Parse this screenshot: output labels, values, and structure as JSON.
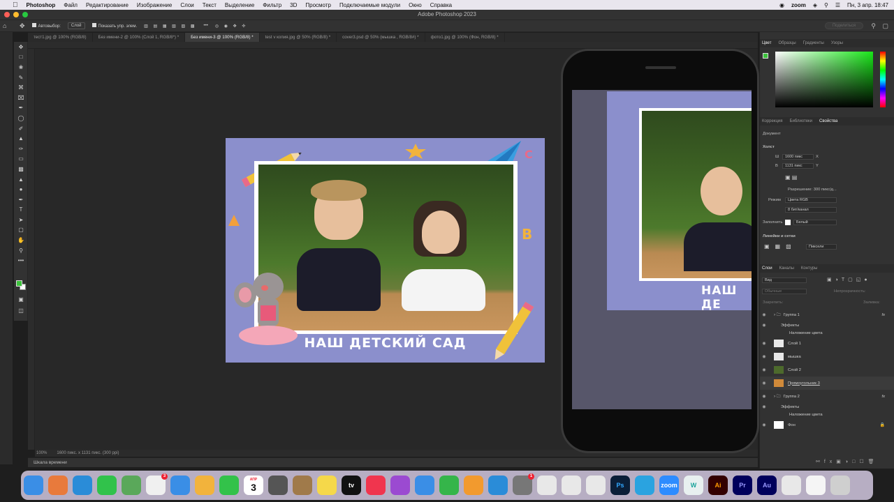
{
  "menubar": {
    "app": "Photoshop",
    "items": [
      "Файл",
      "Редактирование",
      "Изображение",
      "Слои",
      "Текст",
      "Выделение",
      "Фильтр",
      "3D",
      "Просмотр",
      "Подключаемые модули",
      "Окно",
      "Справка"
    ],
    "zoom": "zoom",
    "datetime": "Пн, 3 апр. 18:47"
  },
  "window": {
    "title": "Adobe Photoshop 2023"
  },
  "options": {
    "autoselect_label": "Автовыбор:",
    "autoselect_value": "Слой",
    "show_transform_label": "Показать упр. элем.",
    "share_label": "Поделиться"
  },
  "tabs": [
    "тест1.jpg @ 100% (RGB/8)",
    "Без имени-2 @ 100% (Слой 1, RGB/8*) *",
    "Без имени-3 @ 100% (RGB/8) *",
    "test v копия.jpg @ 50% (RGB/8) *",
    "cover3.psd @ 50% (мышка , RGB/8#) *",
    "фото1.jpg @ 100% (Фон, RGB/8) *"
  ],
  "document": {
    "caption": "НАШ ДЕТСКИЙ САД",
    "letter_b": "B",
    "letter_c": "C"
  },
  "phone": {
    "caption": "НАШ ДЕ"
  },
  "status": {
    "zoom": "100%",
    "size": "1600 пикс. x 1131 пикс. (300 ppi)"
  },
  "timeline": {
    "label": "Шкала времени"
  },
  "panels": {
    "color_tabs": [
      "Цвет",
      "Образцы",
      "Градиенты",
      "Узоры"
    ],
    "props_tabs": [
      "Коррекция",
      "Библиотеки",
      "Свойства"
    ],
    "document_label": "Документ",
    "canvas_label": "Холст",
    "width_label": "Ш",
    "width_value": "1600 пикс",
    "width_unit": "X",
    "height_label": "В",
    "height_value": "1131 пикс",
    "height_unit": "Y",
    "resolution": "Разрешение: 300 пикс/д...",
    "mode_label": "Режим",
    "mode_value": "Цвета RGB",
    "depth_value": "8 бит/канал",
    "fill_label": "Заполнить",
    "fill_value": "Белый",
    "rulers_label": "Линейки и сетки",
    "units_value": "Пиксели",
    "layers_tabs": [
      "Слои",
      "Каналы",
      "Контуры"
    ],
    "kind_value": "Вид",
    "blend_value": "Обычные",
    "opacity_label": "Непрозрачность:",
    "lock_label": "Закрепить:",
    "fill2_label": "Заливка:",
    "layers": [
      {
        "name": "Группа 1",
        "kind": "group",
        "fx": "fx"
      },
      {
        "name": "Эффекты",
        "kind": "sub"
      },
      {
        "name": "Наложение цвета",
        "kind": "sub2"
      },
      {
        "name": "Слой 1",
        "kind": "layer"
      },
      {
        "name": "мышка",
        "kind": "layer"
      },
      {
        "name": "Слой 2",
        "kind": "photo"
      },
      {
        "name": "Прямоугольник 3",
        "kind": "rect"
      },
      {
        "name": "Группа 2",
        "kind": "group",
        "fx": "fx"
      },
      {
        "name": "Эффекты",
        "kind": "sub"
      },
      {
        "name": "Наложение цвета",
        "kind": "sub2"
      },
      {
        "name": "Фон",
        "kind": "bg"
      }
    ]
  },
  "dock": {
    "calendar_month": "АПР",
    "calendar_day": "3",
    "apps": [
      {
        "name": "finder",
        "label": "",
        "color": "#3a8ee6"
      },
      {
        "name": "launchpad",
        "label": "",
        "color": "#e87a3c"
      },
      {
        "name": "safari",
        "label": "",
        "color": "#2a8cd8"
      },
      {
        "name": "messages",
        "label": "",
        "color": "#31c24b"
      },
      {
        "name": "maps",
        "label": "",
        "color": "#5aa85a"
      },
      {
        "name": "reminders",
        "label": "",
        "color": "#f0f0f0",
        "badge": "3"
      },
      {
        "name": "mail",
        "label": "",
        "color": "#3a8ee6"
      },
      {
        "name": "photos",
        "label": "",
        "color": "#f2b33c"
      },
      {
        "name": "facetime",
        "label": "",
        "color": "#33c24a"
      },
      {
        "name": "calendar",
        "label": "",
        "color": "#ffffff"
      },
      {
        "name": "screenshot",
        "label": "",
        "color": "#555"
      },
      {
        "name": "notes-brown",
        "label": "",
        "color": "#a07a4a"
      },
      {
        "name": "notes",
        "label": "",
        "color": "#f5d84a"
      },
      {
        "name": "tv",
        "label": "tv",
        "color": "#111"
      },
      {
        "name": "music",
        "label": "",
        "color": "#f0354e"
      },
      {
        "name": "podcasts",
        "label": "",
        "color": "#9b4ad1"
      },
      {
        "name": "keynote",
        "label": "",
        "color": "#3a8ee6"
      },
      {
        "name": "numbers",
        "label": "",
        "color": "#35b54a"
      },
      {
        "name": "pages",
        "label": "",
        "color": "#f29a2e"
      },
      {
        "name": "app-store",
        "label": "",
        "color": "#2a8cd8"
      },
      {
        "name": "settings",
        "label": "",
        "color": "#777",
        "badge": "1"
      },
      {
        "name": "chrome",
        "label": "",
        "color": "#e8e8e8"
      },
      {
        "name": "acrobat",
        "label": "",
        "color": "#e8e8e8"
      },
      {
        "name": "sketch",
        "label": "",
        "color": "#e8e8e8"
      },
      {
        "name": "photoshop",
        "label": "Ps",
        "color": "#0b1f38"
      },
      {
        "name": "telegram",
        "label": "",
        "color": "#2aa3e0"
      },
      {
        "name": "zoom",
        "label": "zoom",
        "color": "#2d8cff"
      },
      {
        "name": "unknown-w",
        "label": "W",
        "color": "#e8f0f0"
      },
      {
        "name": "illustrator",
        "label": "Ai",
        "color": "#330000"
      },
      {
        "name": "premiere",
        "label": "Pr",
        "color": "#00005b"
      },
      {
        "name": "audition",
        "label": "Au",
        "color": "#00005b"
      },
      {
        "name": "files",
        "label": "",
        "color": "#e8e8e8"
      },
      {
        "name": "qr",
        "label": "",
        "color": "#f5f5f5"
      },
      {
        "name": "trash",
        "label": "",
        "color": "#cfcfcf"
      }
    ]
  }
}
